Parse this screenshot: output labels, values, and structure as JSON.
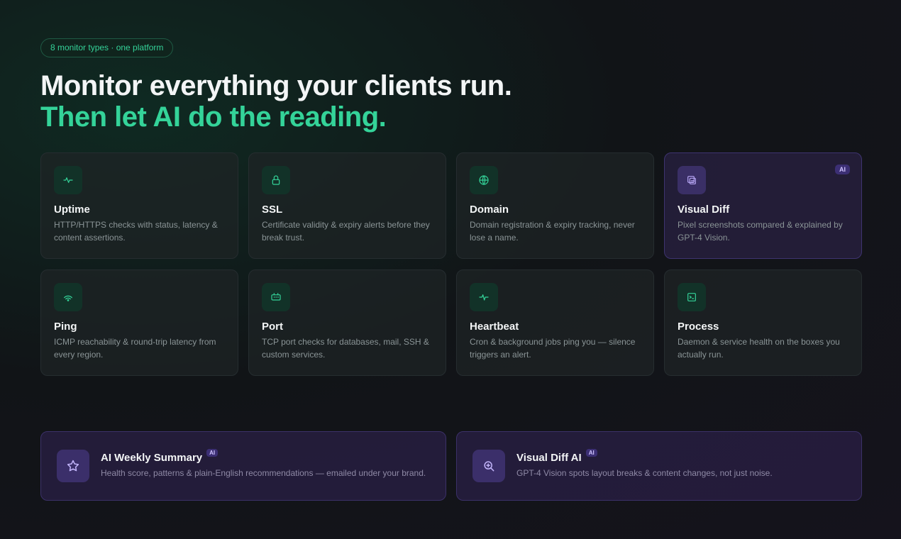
{
  "hero": {
    "pill": "8 monitor types · one platform",
    "headline": "Monitor everything your clients run.",
    "headline_accent": "Then let AI do the reading."
  },
  "monitors": [
    {
      "title": "Uptime",
      "desc": "HTTP/HTTPS checks with status, latency & content assertions.",
      "icon": "pulse-icon"
    },
    {
      "title": "SSL",
      "desc": "Certificate validity & expiry alerts before they break trust.",
      "icon": "lock-icon"
    },
    {
      "title": "Domain",
      "desc": "Domain registration & expiry tracking, never lose a name.",
      "icon": "globe-icon"
    },
    {
      "title": "Visual Diff",
      "desc": "Pixel screenshots compared & explained by GPT-4 Vision.",
      "icon": "image-compare-icon",
      "badge": "AI"
    },
    {
      "title": "Ping",
      "desc": "ICMP reachability & round-trip latency from every region.",
      "icon": "signal-icon"
    },
    {
      "title": "Port",
      "desc": "TCP port checks for databases, mail, SSH & custom services.",
      "icon": "port-icon"
    },
    {
      "title": "Heartbeat",
      "desc": "Cron & background jobs ping you — silence triggers an alert.",
      "icon": "heartbeat-icon"
    },
    {
      "title": "Process",
      "desc": "Daemon & service health on the boxes you actually run.",
      "icon": "terminal-icon"
    }
  ],
  "features": [
    {
      "title": "AI Weekly Summary",
      "badge": "AI",
      "desc": "Health score, patterns & plain-English recommendations — emailed under your brand.",
      "icon": "star-icon"
    },
    {
      "title": "Visual Diff AI",
      "badge": "AI",
      "desc": "GPT-4 Vision spots layout breaks & content changes, not just noise.",
      "icon": "zoom-icon"
    }
  ],
  "colors": {
    "accent": "#34d399",
    "ai": "#3c2f74"
  }
}
